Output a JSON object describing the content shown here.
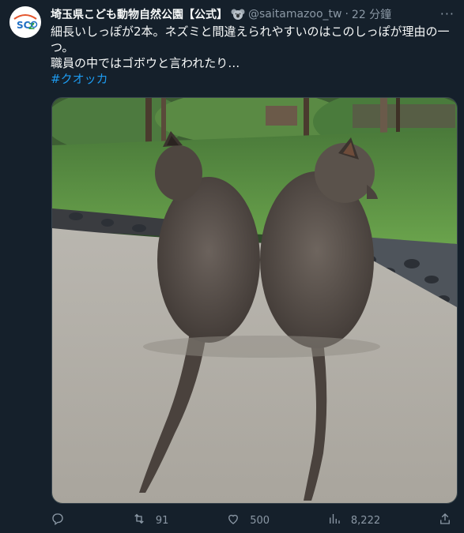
{
  "tweet": {
    "display_name": "埼玉県こども動物自然公園【公式】",
    "handle": "@saitamazoo_tw",
    "separator": "·",
    "time": "22 分鐘",
    "more_label": "···",
    "text_line1": "細長いしっぽが2本。ネズミと間違えられやすいのはこのしっぽが理由の一つ。",
    "text_line2": "職員の中ではゴボウと言われたり…",
    "hashtag": "#クオッカ"
  },
  "actions": {
    "reply_count": "",
    "retweet_count": "91",
    "like_count": "500",
    "views_count": "8,222"
  },
  "colors": {
    "background": "#15202b",
    "text": "#f7f9f9",
    "muted": "#8b98a5",
    "link": "#1d9bf0"
  },
  "icons": [
    "koala-badge-icon",
    "more-icon",
    "reply-icon",
    "retweet-icon",
    "like-icon",
    "views-icon",
    "share-icon"
  ]
}
